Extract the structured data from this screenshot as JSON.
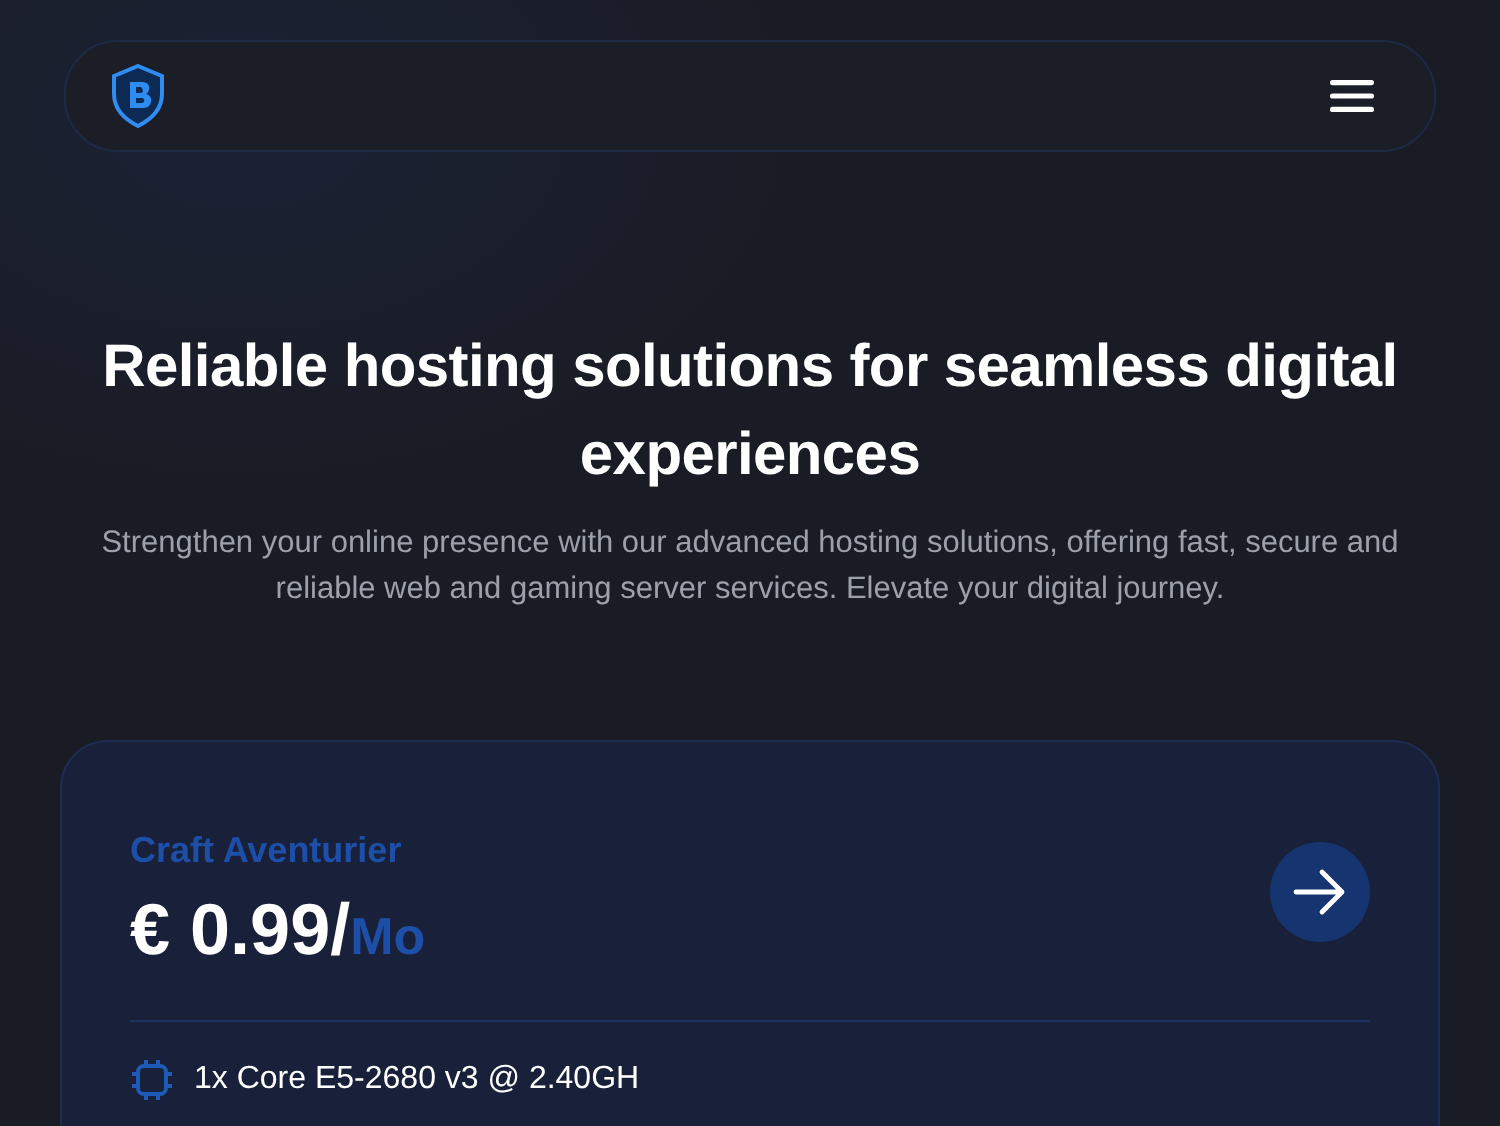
{
  "hero": {
    "title": "Reliable hosting solutions for seamless digital experiences",
    "subtitle": "Strengthen your online presence with our advanced hosting solutions, offering fast, secure and reliable web and gaming server services. Elevate your digital journey."
  },
  "plan": {
    "name": "Craft Aventurier",
    "price": "€ 0.99/",
    "period": "Mo",
    "features": [
      "1x Core E5-2680 v3 @ 2.40GH"
    ]
  }
}
